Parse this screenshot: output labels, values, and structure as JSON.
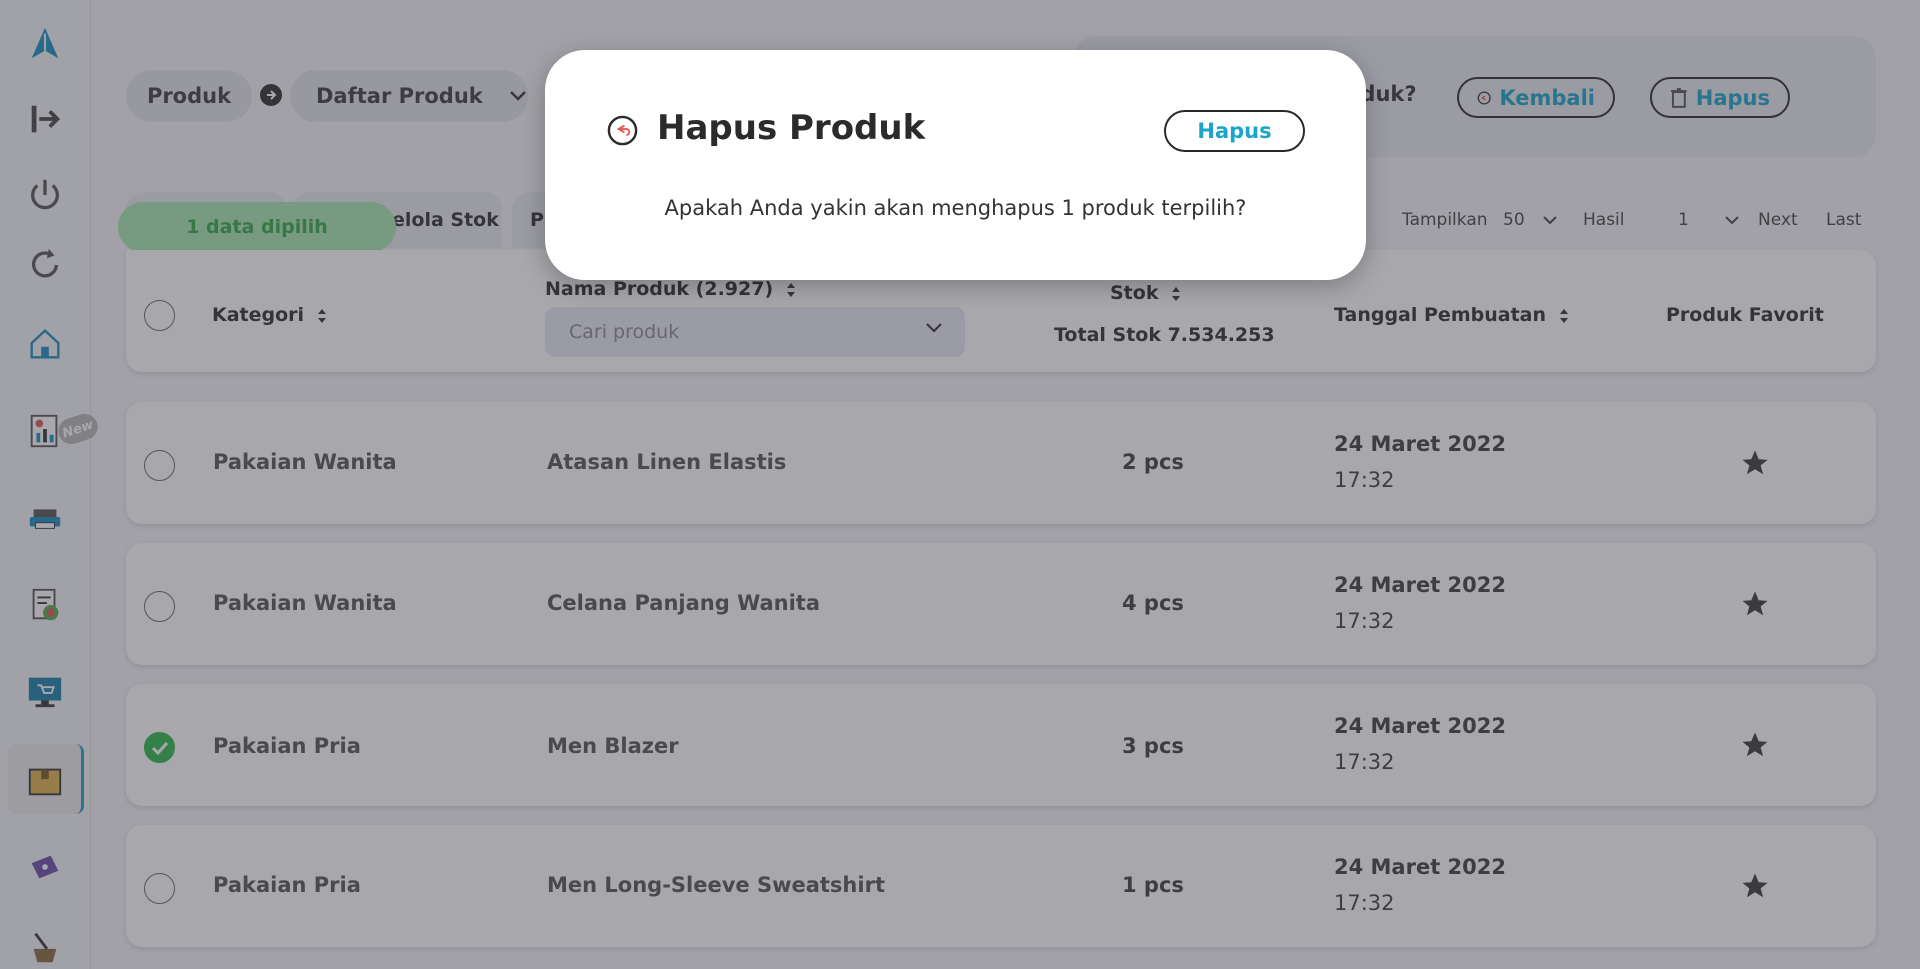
{
  "sidebar": {
    "new_badge": "New",
    "icons": [
      "logo-icon",
      "logout-icon",
      "power-icon",
      "refresh-icon",
      "home-icon",
      "report-icon",
      "printer-icon",
      "invoice-icon",
      "pos-monitor-icon",
      "product-box-icon",
      "voucher-icon",
      "mortar-icon"
    ]
  },
  "breadcrumb": {
    "root": "Produk",
    "current": "Daftar Produk"
  },
  "confirm_bar": {
    "question": "oduk?",
    "back_label": "Kembali",
    "delete_label": "Hapus"
  },
  "tabs": {
    "stock_tab": "elola Stok",
    "third_tab": "P"
  },
  "selection_tip": "1 data dipilih",
  "pager": {
    "show_label": "Tampilkan",
    "page_size": "50",
    "result_label": "Hasil",
    "page": "1",
    "next": "Next",
    "last": "Last"
  },
  "table": {
    "headers": {
      "category": "Kategori",
      "product_name": "Nama Produk (2.927)",
      "search_placeholder": "Cari produk",
      "stock": "Stok",
      "total_stock": "Total Stok 7.534.253",
      "created": "Tanggal Pembuatan",
      "favorite": "Produk Favorit"
    },
    "rows": [
      {
        "category": "Pakaian Wanita",
        "name": "Atasan Linen Elastis",
        "stock": "2 pcs",
        "date": "24 Maret 2022",
        "time": "17:32",
        "checked": false
      },
      {
        "category": "Pakaian Wanita",
        "name": "Celana Panjang Wanita",
        "stock": "4 pcs",
        "date": "24 Maret 2022",
        "time": "17:32",
        "checked": false
      },
      {
        "category": "Pakaian Pria",
        "name": "Men Blazer",
        "stock": "3 pcs",
        "date": "24 Maret 2022",
        "time": "17:32",
        "checked": true
      },
      {
        "category": "Pakaian Pria",
        "name": "Men Long-Sleeve Sweatshirt",
        "stock": "1 pcs",
        "date": "24 Maret 2022",
        "time": "17:32",
        "checked": false
      }
    ]
  },
  "modal": {
    "title": "Hapus Produk",
    "button": "Hapus",
    "message": "Apakah Anda yakin akan menghapus 1 produk terpilih?"
  },
  "colors": {
    "accent": "#1aa5c9",
    "success": "#2fb84a",
    "tip_bg": "#a8e8b0"
  }
}
